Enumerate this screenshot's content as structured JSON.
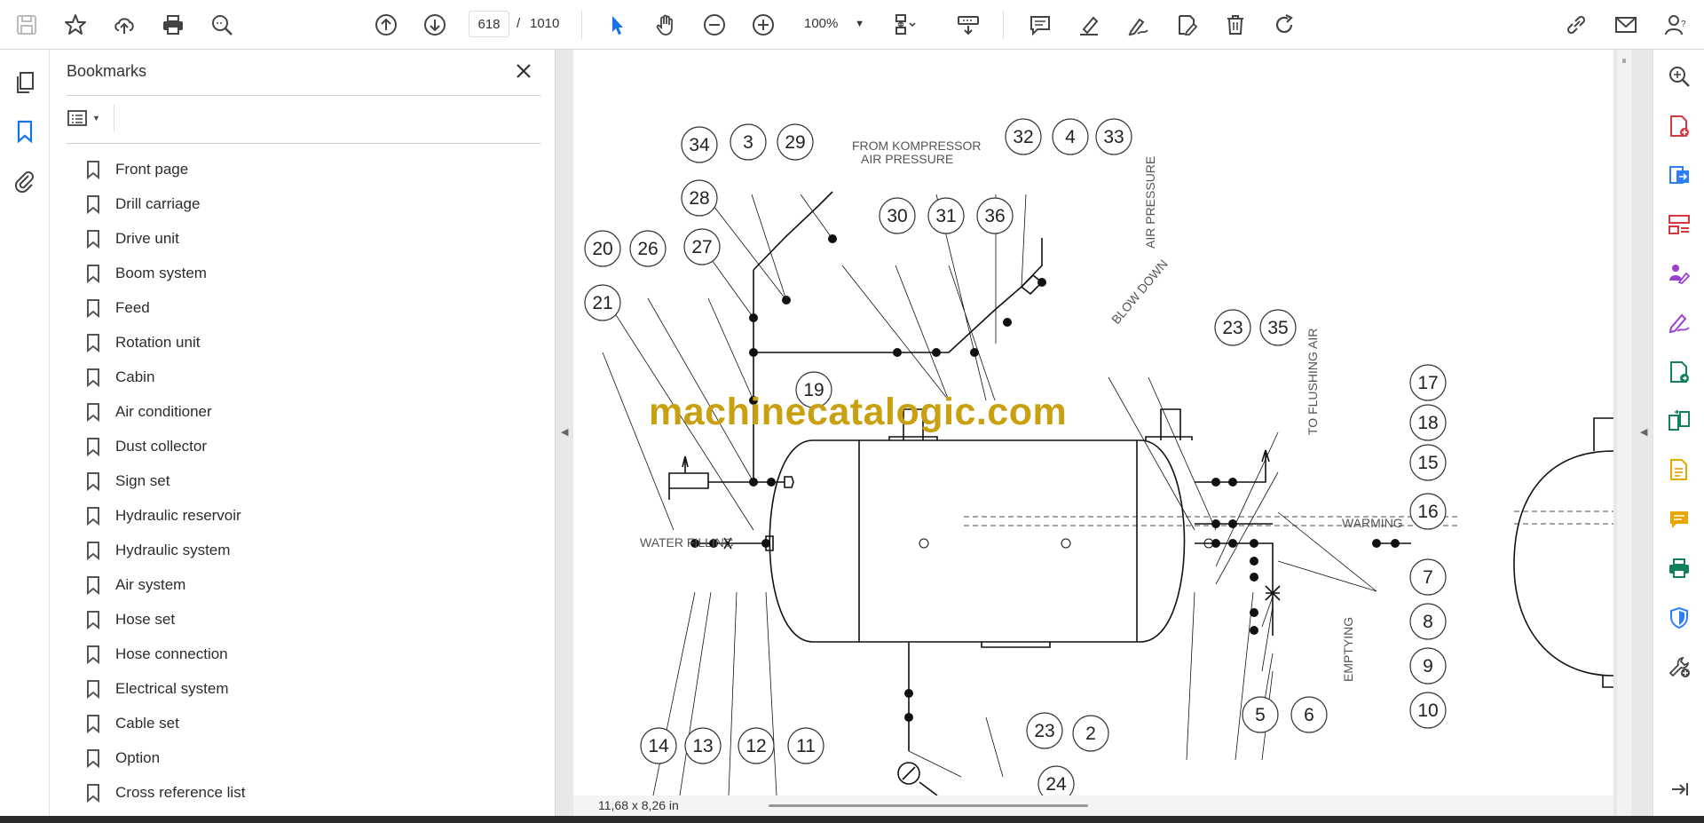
{
  "toolbar": {
    "page_current": "618",
    "page_separator": "/",
    "page_total": "1010",
    "zoom": "100%"
  },
  "bookmarks_panel": {
    "title": "Bookmarks",
    "items": [
      {
        "label": "Front page"
      },
      {
        "label": "Drill carriage"
      },
      {
        "label": "Drive unit"
      },
      {
        "label": "Boom system"
      },
      {
        "label": "Feed"
      },
      {
        "label": "Rotation unit"
      },
      {
        "label": "Cabin"
      },
      {
        "label": "Air conditioner"
      },
      {
        "label": "Dust collector"
      },
      {
        "label": "Sign set"
      },
      {
        "label": "Hydraulic reservoir"
      },
      {
        "label": "Hydraulic system"
      },
      {
        "label": "Air system"
      },
      {
        "label": "Hose set"
      },
      {
        "label": "Hose connection"
      },
      {
        "label": "Electrical system"
      },
      {
        "label": "Cable set"
      },
      {
        "label": "Option"
      },
      {
        "label": "Cross reference list"
      }
    ]
  },
  "document": {
    "watermark": "machinecatalogic.com",
    "page_size": "11,68 x 8,26 in",
    "drawing": {
      "callouts": [
        "34",
        "3",
        "29",
        "28",
        "20",
        "26",
        "27",
        "21",
        "32",
        "4",
        "33",
        "30",
        "31",
        "36",
        "23",
        "35",
        "19",
        "17",
        "18",
        "15",
        "16",
        "7",
        "8",
        "9",
        "10",
        "5",
        "6",
        "14",
        "13",
        "12",
        "11",
        "23",
        "2",
        "24"
      ],
      "labels": {
        "from_kompressor": "FROM KOMPRESSOR",
        "air_pressure_1": "AIR PRESSURE",
        "air_pressure_2": "AIR PRESSURE",
        "blow_down": "BLOW DOWN",
        "to_flushing_air": "TO FLUSHING AIR",
        "water_filling": "WATER FILLING",
        "warming": "WARMING",
        "emptying": "EMPTYING"
      }
    }
  },
  "icons": {
    "save": "save-icon",
    "star": "star-icon",
    "upload": "upload-icon",
    "print": "print-icon",
    "find": "find-icon",
    "prev_page": "arrow-up-circle-icon",
    "next_page": "arrow-down-circle-icon",
    "select": "cursor-icon",
    "hand": "hand-icon",
    "zoom_out": "zoom-out-icon",
    "zoom_in": "zoom-in-icon",
    "accent": "#1473e6"
  }
}
